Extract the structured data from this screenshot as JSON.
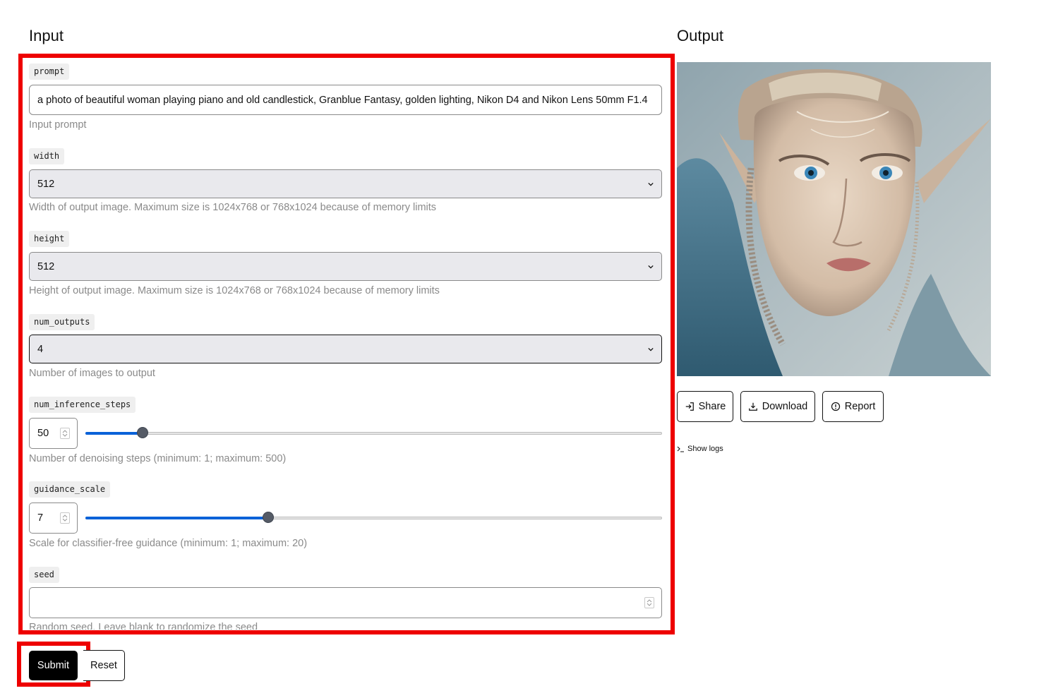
{
  "input_heading": "Input",
  "output_heading": "Output",
  "fields": {
    "prompt": {
      "label": "prompt",
      "value": "a photo of beautiful woman playing piano and old candlestick, Granblue Fantasy, golden lighting, Nikon D4 and Nikon Lens 50mm F1.4",
      "help": "Input prompt"
    },
    "width": {
      "label": "width",
      "value": "512",
      "help": "Width of output image. Maximum size is 1024x768 or 768x1024 because of memory limits"
    },
    "height": {
      "label": "height",
      "value": "512",
      "help": "Height of output image. Maximum size is 1024x768 or 768x1024 because of memory limits"
    },
    "num_outputs": {
      "label": "num_outputs",
      "value": "4",
      "help": "Number of images to output"
    },
    "num_inference_steps": {
      "label": "num_inference_steps",
      "value": "50",
      "min": 1,
      "max": 500,
      "help": "Number of denoising steps (minimum: 1; maximum: 500)"
    },
    "guidance_scale": {
      "label": "guidance_scale",
      "value": "7",
      "min": 1,
      "max": 20,
      "help": "Scale for classifier-free guidance (minimum: 1; maximum: 20)"
    },
    "seed": {
      "label": "seed",
      "value": "",
      "help": "Random seed. Leave blank to randomize the seed"
    }
  },
  "buttons": {
    "submit": "Submit",
    "reset": "Reset",
    "share": "Share",
    "download": "Download",
    "report": "Report",
    "show_logs": "Show logs"
  },
  "icons": {
    "share": "share-icon",
    "download": "download-icon",
    "report": "report-icon",
    "logs": "terminal-icon",
    "chevron": "chevron-down-icon",
    "spinner": "spinner-arrows-icon"
  },
  "colors": {
    "highlight": "#ee0000",
    "slider_fill": "#0a62d8",
    "select_bg": "#e9e9ed"
  }
}
